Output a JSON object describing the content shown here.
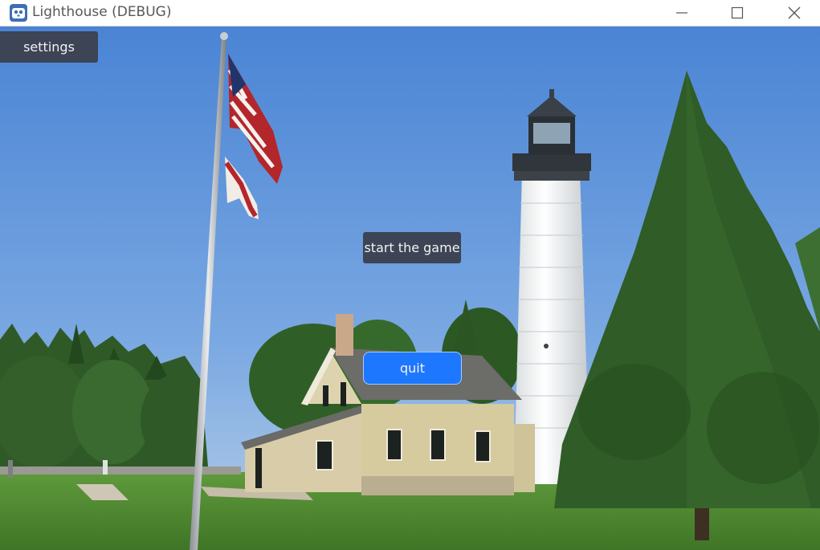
{
  "window": {
    "title": "Lighthouse (DEBUG)",
    "icon": "godot-engine-icon",
    "controls": [
      "minimize-icon",
      "maximize-icon",
      "close-icon"
    ]
  },
  "menu": {
    "settings_label": "settings",
    "start_label": "start the game",
    "quit_label": "quit"
  },
  "colors": {
    "button_dark": "#3c4455",
    "button_accent": "#1e77ff",
    "sky": "#5b8fd6",
    "grass": "#4f8a32"
  }
}
